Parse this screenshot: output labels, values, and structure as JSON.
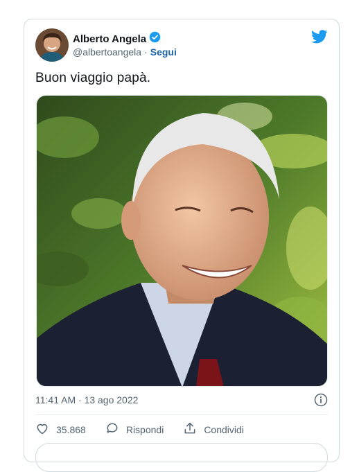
{
  "author": {
    "name": "Alberto Angela",
    "handle": "@albertoangela",
    "separator": "·",
    "follow_label": "Segui"
  },
  "icons": {
    "verified": "verified-badge-icon",
    "brand": "twitter-bird-icon",
    "info": "info-icon",
    "like": "heart-icon",
    "reply": "speech-bubble-icon",
    "share": "share-icon"
  },
  "colors": {
    "brand": "#1d9bf0",
    "link": "#1d65a6",
    "muted": "#536471",
    "border": "#cfd9de"
  },
  "tweet": {
    "text": "Buon viaggio papà.",
    "timestamp": "11:41 AM · 13 ago 2022"
  },
  "actions": {
    "likes": "35.868",
    "reply_label": "Rispondi",
    "share_label": "Condividi"
  }
}
